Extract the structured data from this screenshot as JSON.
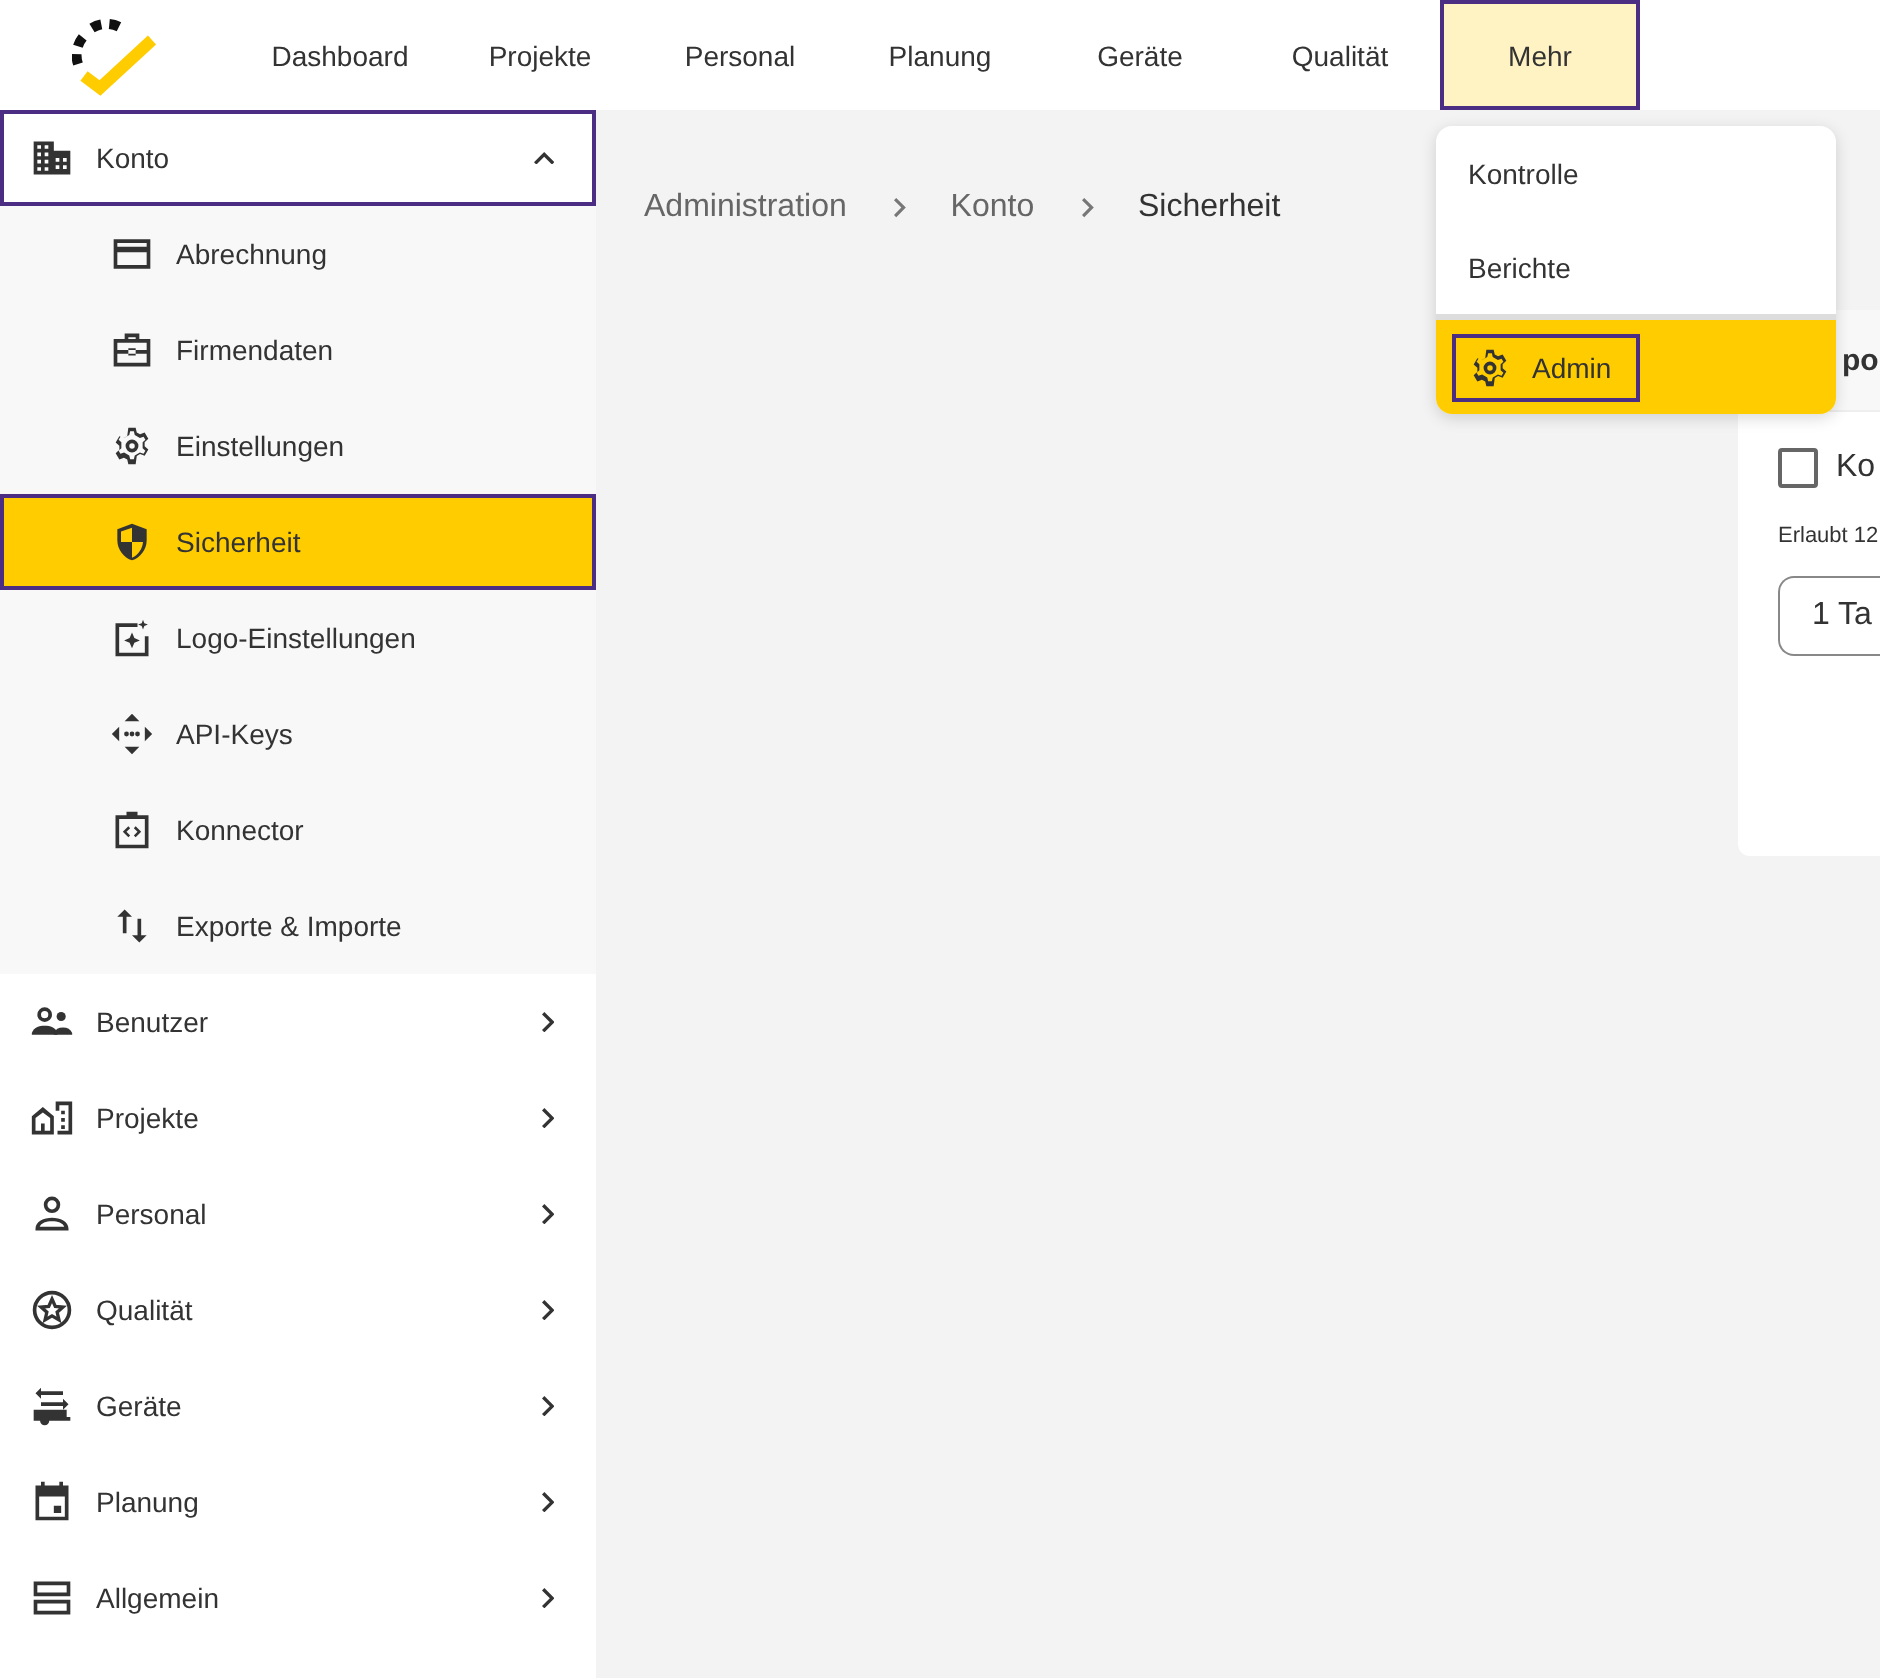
{
  "topnav": {
    "items": [
      {
        "label": "Dashboard",
        "selected": false,
        "highlighted": false
      },
      {
        "label": "Projekte",
        "selected": false,
        "highlighted": false
      },
      {
        "label": "Personal",
        "selected": false,
        "highlighted": false
      },
      {
        "label": "Planung",
        "selected": false,
        "highlighted": false
      },
      {
        "label": "Geräte",
        "selected": false,
        "highlighted": false
      },
      {
        "label": "Qualität",
        "selected": false,
        "highlighted": false
      },
      {
        "label": "Mehr",
        "selected": true,
        "highlighted": true
      }
    ]
  },
  "dropdown": {
    "items": [
      {
        "label": "Kontrolle",
        "selected": false,
        "highlighted": false
      },
      {
        "label": "Berichte",
        "selected": false,
        "highlighted": false
      },
      {
        "label": "Admin",
        "selected": true,
        "highlighted": true
      }
    ]
  },
  "sidebar": {
    "items": [
      {
        "label": "Konto",
        "expanded": true,
        "highlighted": true,
        "children": [
          {
            "label": "Abrechnung",
            "selected": false,
            "highlighted": false
          },
          {
            "label": "Firmendaten",
            "selected": false,
            "highlighted": false
          },
          {
            "label": "Einstellungen",
            "selected": false,
            "highlighted": false
          },
          {
            "label": "Sicherheit",
            "selected": true,
            "highlighted": true
          },
          {
            "label": "Logo-Einstellungen",
            "selected": false,
            "highlighted": false
          },
          {
            "label": "API-Keys",
            "selected": false,
            "highlighted": false
          },
          {
            "label": "Konnector",
            "selected": false,
            "highlighted": false
          },
          {
            "label": "Exporte & Importe",
            "selected": false,
            "highlighted": false
          }
        ]
      },
      {
        "label": "Benutzer",
        "expanded": false,
        "highlighted": false
      },
      {
        "label": "Projekte",
        "expanded": false,
        "highlighted": false
      },
      {
        "label": "Personal",
        "expanded": false,
        "highlighted": false
      },
      {
        "label": "Qualität",
        "expanded": false,
        "highlighted": false
      },
      {
        "label": "Geräte",
        "expanded": false,
        "highlighted": false
      },
      {
        "label": "Planung",
        "expanded": false,
        "highlighted": false
      },
      {
        "label": "Allgemein",
        "expanded": false,
        "highlighted": false
      }
    ]
  },
  "breadcrumb": [
    "Administration",
    "Konto",
    "Sicherheit"
  ],
  "card": {
    "title": "po",
    "checkbox": {
      "label": "Ko",
      "checked": false
    },
    "hint": "Erlaubt 12",
    "select": {
      "value": "1 Ta"
    }
  }
}
